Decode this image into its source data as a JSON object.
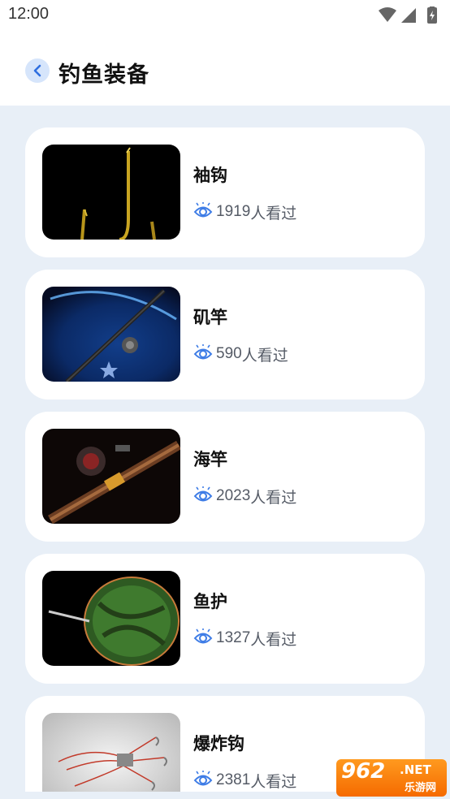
{
  "status_bar": {
    "time": "12:00",
    "icons": [
      "wifi-icon",
      "cellular-icon",
      "battery-charging-icon"
    ]
  },
  "header": {
    "back_icon": "chevron-left-icon",
    "title": "钓鱼装备"
  },
  "items": [
    {
      "title": "袖钩",
      "views": "1919",
      "views_suffix": "人看过",
      "thumb": "hook-image"
    },
    {
      "title": "矶竿",
      "views": "590",
      "views_suffix": "人看过",
      "thumb": "rod-planet-image"
    },
    {
      "title": "海竿",
      "views": "2023",
      "views_suffix": "人看过",
      "thumb": "sea-rod-image"
    },
    {
      "title": "鱼护",
      "views": "1327",
      "views_suffix": "人看过",
      "thumb": "fish-net-image"
    },
    {
      "title": "爆炸钩",
      "views": "2381",
      "views_suffix": "人看过",
      "thumb": "explosion-hook-image"
    }
  ],
  "watermark": {
    "main": "962",
    "net": ".NET",
    "sub": "乐游网"
  },
  "colors": {
    "accent": "#3f7de6",
    "background": "#e8eff7",
    "card": "#ffffff",
    "watermark": "#f57c00"
  }
}
